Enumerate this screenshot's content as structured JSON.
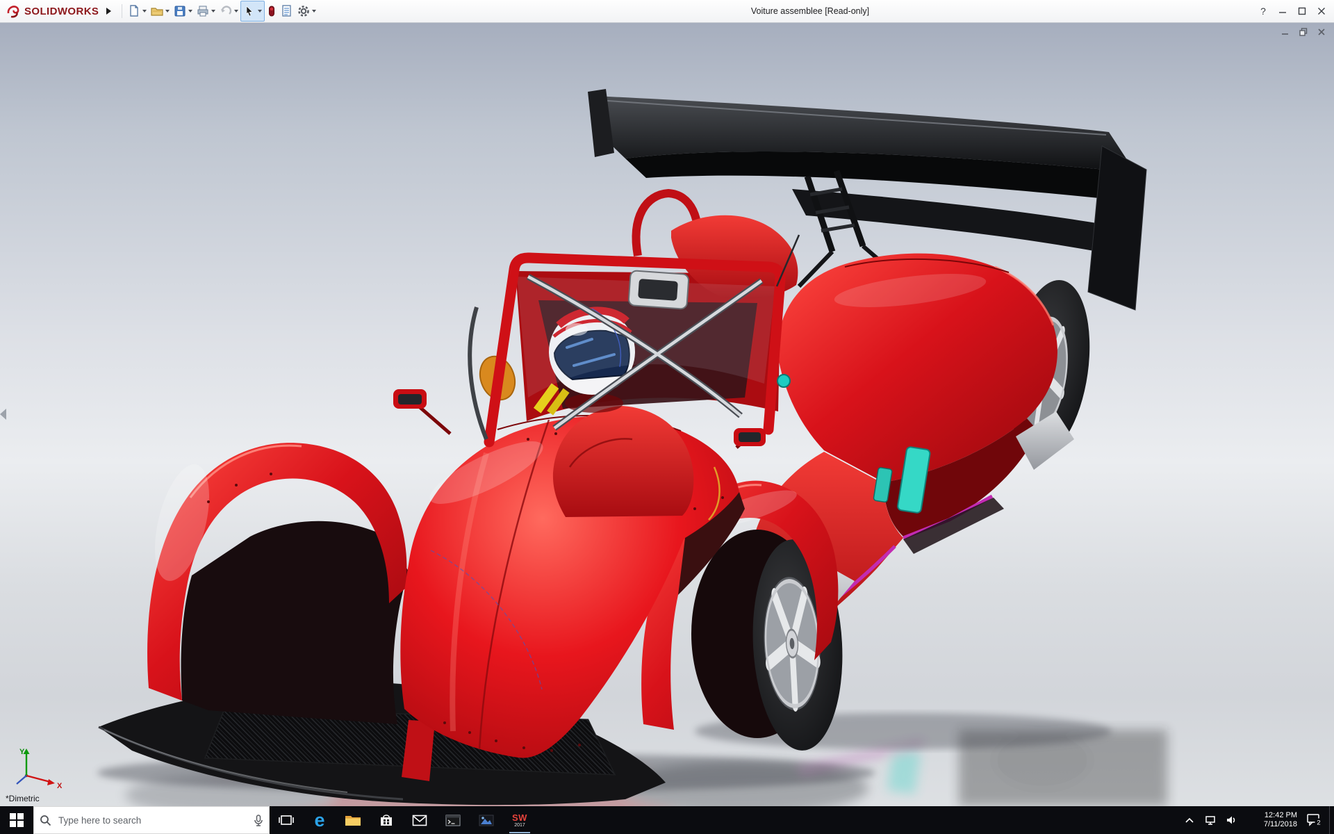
{
  "window": {
    "brand": "SOLIDWORKS",
    "title": "Voiture assemblee [Read-only]",
    "help": "?"
  },
  "toolbar": {
    "buttons": [
      "new-document",
      "open",
      "save",
      "print",
      "undo",
      "select",
      "rebuild",
      "file-properties",
      "options"
    ]
  },
  "viewport": {
    "view_orientation": "*Dimetric",
    "triad": {
      "x": "X",
      "y": "Y"
    },
    "doc_window_controls": [
      "minimize",
      "restore",
      "close"
    ]
  },
  "taskbar": {
    "search": {
      "placeholder": "Type here to search"
    },
    "edge_glyph": "e",
    "pinned": [
      "start",
      "search",
      "task-view",
      "edge",
      "file-explorer",
      "store",
      "mail",
      "command-prompt",
      "photos",
      "solidworks-2017"
    ],
    "solidworks_icon": {
      "text": "SW",
      "year": "2017"
    },
    "tray": {
      "time": "12:42 PM",
      "date": "7/11/2018",
      "notification_count": "2"
    }
  },
  "colors": {
    "body_red": "#d8121a",
    "wing_black": "#101114",
    "accent_cyan": "#2fd6c8",
    "accent_magenta": "#c22bb2",
    "taskbar": "#0b0c10",
    "viewport_top": "#a6aebe",
    "viewport_mid": "#ebedf0"
  }
}
